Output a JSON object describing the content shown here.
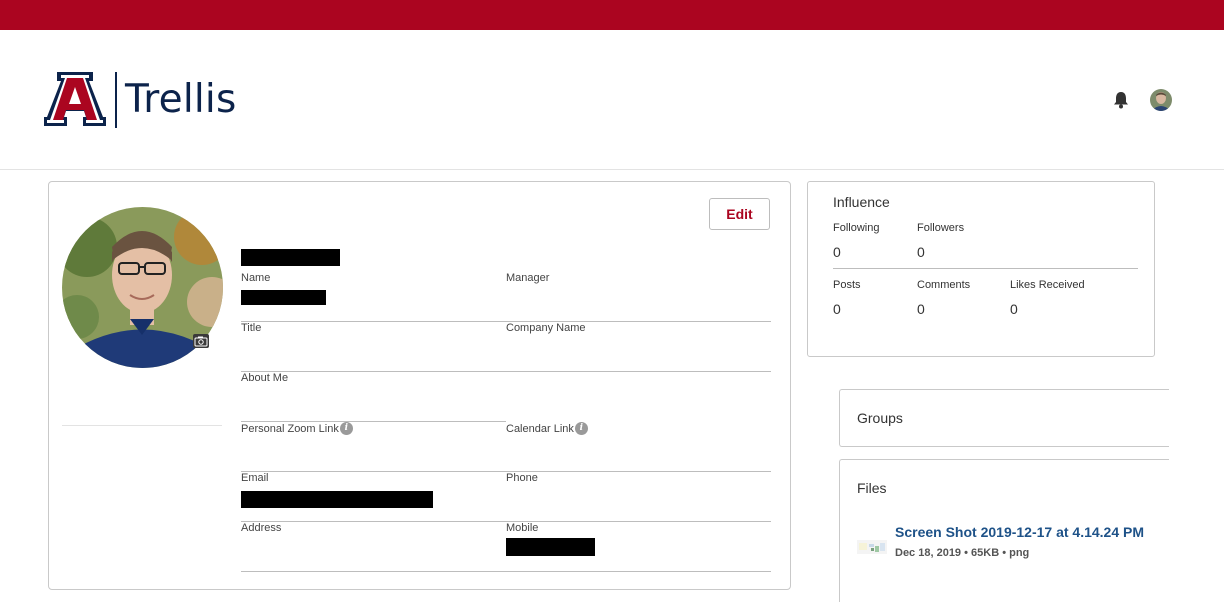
{
  "colors": {
    "top_bar": "#ab0520",
    "brand_navy": "#0c234b",
    "link_blue": "#1e5288"
  },
  "header": {
    "brand": "Trellis",
    "bell_icon": "bell-icon",
    "avatar": "user-avatar"
  },
  "profile": {
    "edit_label": "Edit",
    "fields": {
      "name": "Name",
      "manager": "Manager",
      "title": "Title",
      "company_name": "Company Name",
      "about_me": "About Me",
      "zoom_link": "Personal Zoom Link",
      "calendar_link": "Calendar Link",
      "email": "Email",
      "phone": "Phone",
      "address": "Address",
      "mobile": "Mobile"
    },
    "info_glyph": "i"
  },
  "influence": {
    "title": "Influence",
    "following_label": "Following",
    "following_value": "0",
    "followers_label": "Followers",
    "followers_value": "0",
    "posts_label": "Posts",
    "posts_value": "0",
    "comments_label": "Comments",
    "comments_value": "0",
    "likes_label": "Likes Received",
    "likes_value": "0"
  },
  "groups": {
    "title": "Groups"
  },
  "files": {
    "title": "Files",
    "items": [
      {
        "name": "Screen Shot 2019-12-17 at 4.14.24 PM",
        "meta": "Dec 18, 2019 • 65KB • png"
      }
    ]
  }
}
